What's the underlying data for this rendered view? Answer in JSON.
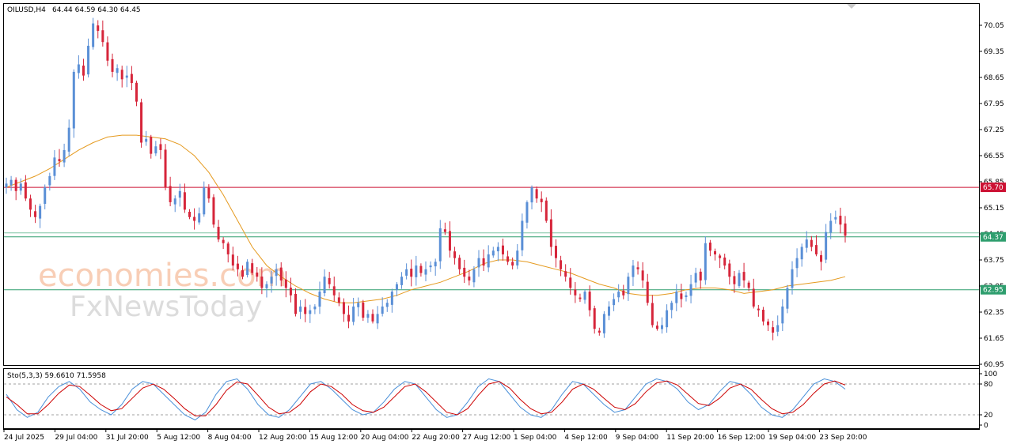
{
  "chart_header": {
    "symbol": "OILUSD,H4",
    "ohlc": "64.44 64.59 64.30 64.45"
  },
  "watermark": {
    "line1": "economies.com",
    "line2": "FxNewsToday"
  },
  "chart_data": [
    {
      "type": "candlestick",
      "ylim": [
        60.95,
        70.3
      ],
      "y_ticks": [
        "70.05",
        "69.35",
        "68.65",
        "67.95",
        "67.25",
        "66.55",
        "65.85",
        "65.15",
        "64.45",
        "63.75",
        "63.05",
        "62.35",
        "61.65",
        "60.95"
      ],
      "x_ticks": [
        "24 Jul 2025",
        "29 Jul 04:00",
        "31 Jul 20:00",
        "5 Aug 12:00",
        "8 Aug 04:00",
        "12 Aug 20:00",
        "15 Aug 12:00",
        "20 Aug 04:00",
        "22 Aug 20:00",
        "27 Aug 12:00",
        "1 Sep 04:00",
        "4 Sep 12:00",
        "9 Sep 04:00",
        "11 Sep 20:00",
        "16 Sep 12:00",
        "19 Sep 04:00",
        "23 Sep 20:00"
      ],
      "price_labels": [
        {
          "value": 65.7,
          "text": "65.70",
          "color": "#cc1133"
        },
        {
          "value": 64.37,
          "text": "64.37",
          "color": "#2e9e6e"
        },
        {
          "value": 62.95,
          "text": "62.95",
          "color": "#2e9e6e"
        }
      ],
      "closes": [
        65.8,
        65.9,
        65.6,
        65.8,
        65.4,
        65.1,
        64.9,
        65.2,
        65.7,
        66.0,
        66.5,
        66.4,
        66.7,
        67.3,
        68.8,
        69.0,
        68.7,
        69.5,
        70.1,
        69.9,
        69.6,
        69.1,
        68.8,
        68.9,
        68.6,
        68.7,
        68.5,
        68.0,
        66.9,
        67.0,
        66.6,
        66.8,
        66.7,
        65.7,
        65.3,
        65.4,
        65.6,
        65.1,
        64.9,
        64.8,
        65.0,
        65.7,
        65.4,
        64.7,
        64.3,
        64.2,
        63.9,
        63.6,
        63.5,
        63.3,
        63.7,
        63.4,
        63.3,
        63.0,
        63.1,
        63.3,
        63.5,
        63.2,
        63.0,
        62.8,
        62.3,
        62.5,
        62.3,
        62.4,
        62.5,
        62.9,
        63.3,
        63.1,
        62.8,
        62.6,
        62.3,
        62.1,
        62.5,
        62.6,
        62.2,
        62.3,
        62.1,
        62.3,
        62.5,
        62.6,
        62.9,
        63.1,
        63.3,
        63.5,
        63.3,
        63.6,
        63.4,
        63.5,
        63.6,
        63.7,
        64.6,
        64.5,
        64.0,
        63.8,
        63.5,
        63.3,
        63.2,
        63.5,
        63.8,
        63.6,
        63.9,
        64.0,
        64.1,
        63.9,
        63.7,
        63.6,
        64.0,
        64.8,
        65.3,
        65.7,
        65.4,
        65.3,
        64.8,
        64.1,
        63.8,
        63.5,
        63.3,
        63.0,
        62.8,
        62.7,
        62.9,
        62.4,
        61.9,
        61.8,
        62.3,
        62.5,
        62.7,
        62.9,
        62.8,
        63.3,
        63.6,
        63.5,
        63.2,
        62.6,
        62.0,
        61.9,
        62.0,
        62.4,
        62.6,
        62.9,
        62.7,
        62.8,
        63.1,
        63.4,
        63.2,
        64.2,
        64.0,
        63.9,
        63.8,
        63.6,
        63.3,
        63.1,
        63.4,
        63.2,
        63.0,
        62.5,
        62.4,
        62.1,
        62.0,
        61.8,
        62.0,
        62.5,
        63.0,
        63.5,
        63.8,
        64.1,
        64.3,
        64.1,
        63.9,
        63.7,
        64.5,
        64.8,
        64.9,
        64.7,
        64.4
      ],
      "ma": [
        65.7,
        65.85,
        66.0,
        66.2,
        66.45,
        66.7,
        66.9,
        67.05,
        67.1,
        67.1,
        67.05,
        67.0,
        66.85,
        66.55,
        66.1,
        65.5,
        64.8,
        64.1,
        63.6,
        63.3,
        63.05,
        62.85,
        62.7,
        62.6,
        62.6,
        62.65,
        62.7,
        62.8,
        62.95,
        63.05,
        63.15,
        63.3,
        63.45,
        63.65,
        63.75,
        63.75,
        63.7,
        63.6,
        63.5,
        63.4,
        63.25,
        63.1,
        63.0,
        62.85,
        62.8,
        62.8,
        62.85,
        62.95,
        63.0,
        63.0,
        62.95,
        62.85,
        62.9,
        62.95,
        63.05,
        63.1,
        63.15,
        63.2,
        63.3
      ]
    },
    {
      "type": "line",
      "title": "Sto(5,3,3) 59.6610 71.5958",
      "ylim": [
        0,
        100
      ],
      "y_ticks": [
        "100",
        "80",
        "20",
        "0"
      ],
      "series": [
        {
          "name": "main",
          "color": "#4a90d9",
          "values": [
            60,
            30,
            15,
            25,
            55,
            75,
            85,
            70,
            45,
            30,
            20,
            40,
            70,
            85,
            80,
            60,
            40,
            20,
            10,
            25,
            60,
            85,
            90,
            70,
            40,
            20,
            15,
            30,
            55,
            80,
            85,
            70,
            50,
            30,
            20,
            25,
            45,
            70,
            85,
            80,
            55,
            30,
            15,
            20,
            45,
            75,
            90,
            85,
            60,
            35,
            20,
            15,
            30,
            60,
            85,
            80,
            60,
            40,
            25,
            30,
            55,
            80,
            90,
            85,
            70,
            45,
            30,
            40,
            65,
            85,
            80,
            60,
            35,
            20,
            15,
            30,
            55,
            80,
            90,
            85,
            70
          ]
        },
        {
          "name": "signal",
          "color": "#cc0000",
          "values": [
            55,
            40,
            22,
            22,
            40,
            62,
            78,
            75,
            58,
            40,
            28,
            32,
            52,
            72,
            80,
            70,
            52,
            32,
            18,
            18,
            40,
            68,
            84,
            80,
            58,
            35,
            22,
            25,
            40,
            65,
            80,
            75,
            60,
            40,
            28,
            25,
            35,
            55,
            75,
            80,
            65,
            45,
            25,
            20,
            32,
            58,
            80,
            85,
            72,
            50,
            32,
            22,
            25,
            45,
            70,
            80,
            70,
            52,
            35,
            30,
            42,
            65,
            82,
            86,
            78,
            60,
            42,
            38,
            52,
            72,
            80,
            70,
            50,
            32,
            22,
            25,
            40,
            62,
            80,
            86,
            78
          ]
        }
      ]
    }
  ]
}
